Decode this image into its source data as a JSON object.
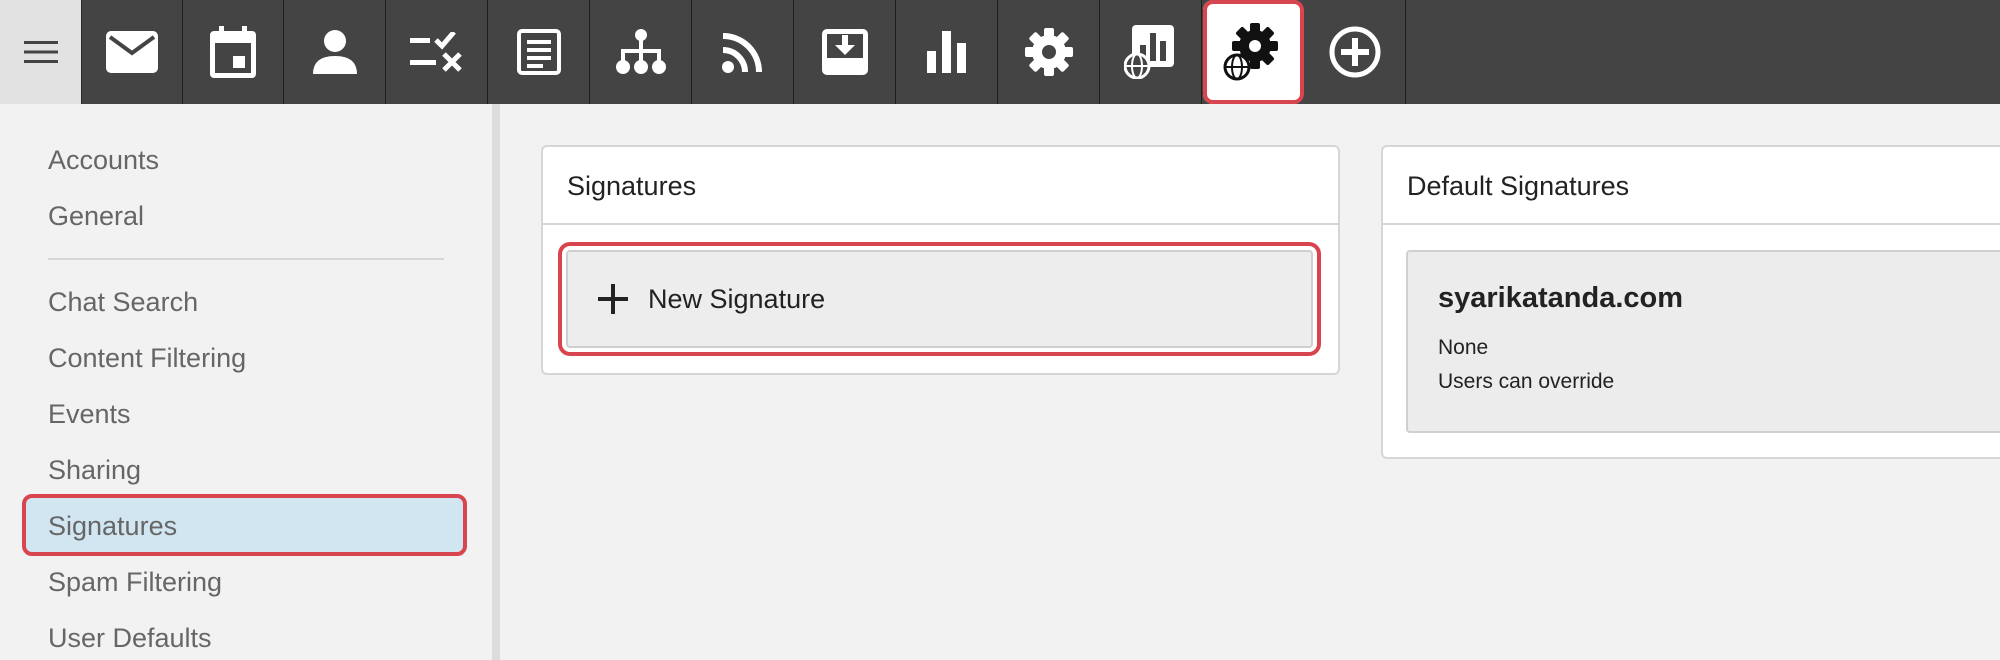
{
  "toolbar": {
    "menu_icon": "hamburger-icon",
    "buttons": [
      {
        "icon": "mail-icon"
      },
      {
        "icon": "calendar-icon"
      },
      {
        "icon": "person-icon"
      },
      {
        "icon": "tasks-icon"
      },
      {
        "icon": "notes-icon"
      },
      {
        "icon": "org-chart-icon"
      },
      {
        "icon": "rss-icon"
      },
      {
        "icon": "inbox-download-icon"
      },
      {
        "icon": "bar-chart-icon"
      },
      {
        "icon": "gear-icon"
      },
      {
        "icon": "domain-reports-icon"
      },
      {
        "icon": "domain-settings-icon",
        "active": true
      },
      {
        "icon": "add-circle-icon"
      }
    ]
  },
  "sidebar": {
    "top_items": [
      "Accounts",
      "General"
    ],
    "items": [
      "Chat Search",
      "Content Filtering",
      "Events",
      "Sharing",
      "Signatures",
      "Spam Filtering",
      "User Defaults"
    ],
    "selected": "Signatures"
  },
  "signatures_panel": {
    "title": "Signatures",
    "new_button_label": "New Signature"
  },
  "defaults_panel": {
    "title": "Default Signatures",
    "domain": "syarikatanda.com",
    "signature": "None",
    "override": "Users can override"
  },
  "colors": {
    "toolbar_bg": "#444444",
    "highlight": "#d9454e",
    "selected_bg": "#d2e6f1"
  }
}
